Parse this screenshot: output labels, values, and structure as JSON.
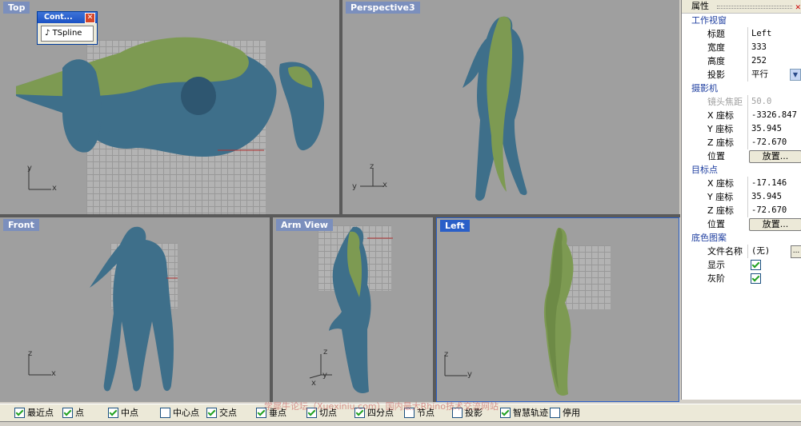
{
  "viewports": {
    "top": {
      "title": "Top"
    },
    "perspective": {
      "title": "Perspective3"
    },
    "front": {
      "title": "Front"
    },
    "arm": {
      "title": "Arm View"
    },
    "left": {
      "title": "Left"
    }
  },
  "axes": {
    "x": "x",
    "y": "y",
    "z": "z"
  },
  "float_window": {
    "title": "Cont...",
    "button": "TSpline"
  },
  "panel": {
    "title": "属性",
    "section_viewport": "工作视窗",
    "rows_viewport": [
      {
        "key": "标题",
        "value": "Left"
      },
      {
        "key": "宽度",
        "value": "333"
      },
      {
        "key": "高度",
        "value": "252"
      },
      {
        "key": "投影",
        "value": "平行"
      }
    ],
    "section_camera": "摄影机",
    "lens": {
      "key": "镜头焦距",
      "value": "50.0"
    },
    "rows_camera": [
      {
        "key": "X 座标",
        "value": "-3326.847"
      },
      {
        "key": "Y 座标",
        "value": "35.945"
      },
      {
        "key": "Z 座标",
        "value": "-72.670"
      }
    ],
    "camera_position": {
      "key": "位置",
      "button": "放置..."
    },
    "section_target": "目标点",
    "rows_target": [
      {
        "key": "X 座标",
        "value": "-17.146"
      },
      {
        "key": "Y 座标",
        "value": "35.945"
      },
      {
        "key": "Z 座标",
        "value": "-72.670"
      }
    ],
    "target_position": {
      "key": "位置",
      "button": "放置..."
    },
    "section_background": "底色图案",
    "file_name": {
      "key": "文件名称",
      "value": "(无)",
      "button": "..."
    },
    "show": {
      "key": "显示"
    },
    "gray": {
      "key": "灰阶"
    }
  },
  "snaps": [
    {
      "label": "最近点",
      "checked": true
    },
    {
      "label": "点",
      "checked": true
    },
    {
      "label": "中点",
      "checked": true
    },
    {
      "label": "中心点",
      "checked": false
    },
    {
      "label": "交点",
      "checked": true
    },
    {
      "label": "垂点",
      "checked": true
    },
    {
      "label": "切点",
      "checked": true
    },
    {
      "label": "四分点",
      "checked": true
    },
    {
      "label": "节点",
      "checked": false
    },
    {
      "label": "投影",
      "checked": false
    },
    {
      "label": "智慧轨迹",
      "checked": true
    },
    {
      "label": "停用",
      "checked": false
    }
  ],
  "watermark": "学犀牛论坛（Xuexiniu.com）国内最大Rhino技术交流网站",
  "colors": {
    "viewport_bg": "#9f9f9f",
    "model_blue": "#3e6f8a",
    "model_green": "#7d9a52",
    "active_title": "#2a5fc8"
  }
}
